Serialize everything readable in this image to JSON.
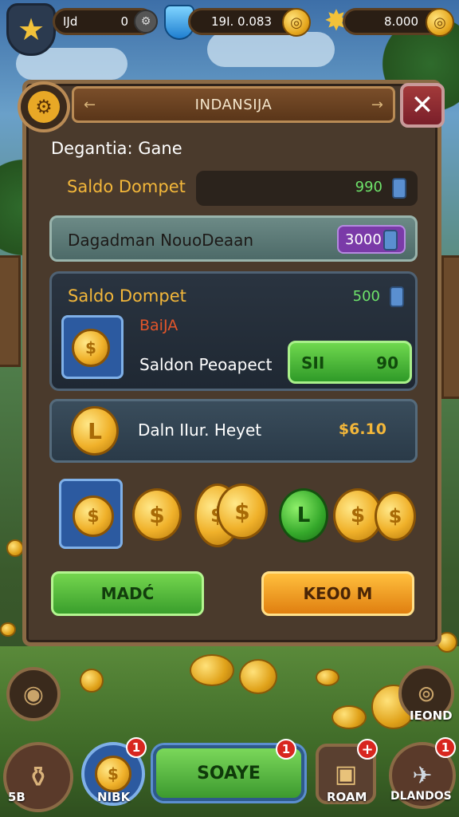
{
  "topbar": {
    "player_label": "IJd",
    "player_value": "0",
    "gems_value": "19I. 0.083",
    "gold_value": "8.000"
  },
  "dialog": {
    "title": "INDANSIJA",
    "subtitle": "Degantia: Gane",
    "wallet_label": "Saldo Dompet",
    "wallet_value": "990",
    "row2_label": "Dagadman NouoDeaan",
    "row2_value": "3000",
    "card": {
      "label": "Saldo Dompet",
      "value": "500",
      "sub_label": "BaiJA",
      "desc": "Saldon Peoapect",
      "pill_left": "SII",
      "pill_right": "90"
    },
    "row4_label": "Daln IIur. Heyet",
    "row4_value": "$6.10",
    "button_left": "MADĆ",
    "button_right": "KEO0 M"
  },
  "bottom_nav": {
    "item1_label": "5B",
    "item2_label": "NIBK",
    "center_label": "SOAYE",
    "item4_label": "ROAM",
    "item5_label": "DLANDOS",
    "side_label": "IEOND",
    "badge_value": "1"
  },
  "colors": {
    "panel_bg": "#4a3a2c",
    "gold": "#f3b73a",
    "green_value": "#6ee36a",
    "close_red": "#a33a3a"
  },
  "icons": {
    "top_left": "star-icon",
    "gems": "shield-gem-icon",
    "gold": "gold-coin-icon",
    "settings": "gear-icon",
    "close": "close-icon"
  }
}
